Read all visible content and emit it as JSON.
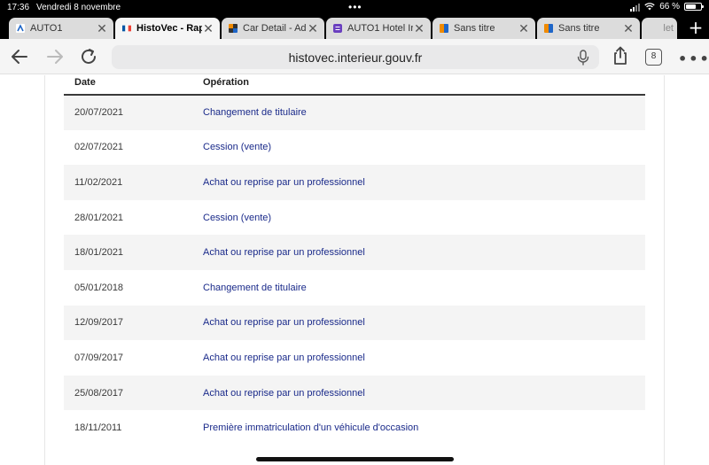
{
  "status_bar": {
    "time": "17:36",
    "date": "Vendredi 8 novembre",
    "battery": "66 %",
    "battery_level": 0.66
  },
  "tabs": [
    {
      "label": "AUTO1",
      "favicon": "auto1-icon",
      "active": false
    },
    {
      "label": "HistoVec - Rap",
      "favicon": "french-flag-icon",
      "active": true
    },
    {
      "label": "Car Detail - Ad",
      "favicon": "car-detail-icon",
      "active": false
    },
    {
      "label": "AUTO1 Hotel Ir",
      "favicon": "hotel-icon",
      "active": false
    },
    {
      "label": "Sans titre",
      "favicon": "sans-titre-icon",
      "active": false
    },
    {
      "label": "Sans titre",
      "favicon": "sans-titre-icon",
      "active": false
    },
    {
      "label": "let",
      "favicon": "",
      "active": false
    }
  ],
  "toolbar": {
    "url": "histovec.interieur.gouv.fr",
    "tabs_count": "8"
  },
  "table": {
    "headers": {
      "date": "Date",
      "operation": "Opération"
    },
    "rows": [
      {
        "date": "20/07/2021",
        "operation": "Changement de titulaire"
      },
      {
        "date": "02/07/2021",
        "operation": "Cession (vente)"
      },
      {
        "date": "11/02/2021",
        "operation": "Achat ou reprise par un professionnel"
      },
      {
        "date": "28/01/2021",
        "operation": "Cession (vente)"
      },
      {
        "date": "18/01/2021",
        "operation": "Achat ou reprise par un professionnel"
      },
      {
        "date": "05/01/2018",
        "operation": "Changement de titulaire"
      },
      {
        "date": "12/09/2017",
        "operation": "Achat ou reprise par un professionnel"
      },
      {
        "date": "07/09/2017",
        "operation": "Achat ou reprise par un professionnel"
      },
      {
        "date": "25/08/2017",
        "operation": "Achat ou reprise par un professionnel"
      },
      {
        "date": "18/11/2011",
        "operation": "Première immatriculation d'un véhicule d'occasion"
      }
    ]
  },
  "colors": {
    "link": "#1a2a8a",
    "row_alt": "#f4f4f4",
    "status_bg": "#000000"
  }
}
